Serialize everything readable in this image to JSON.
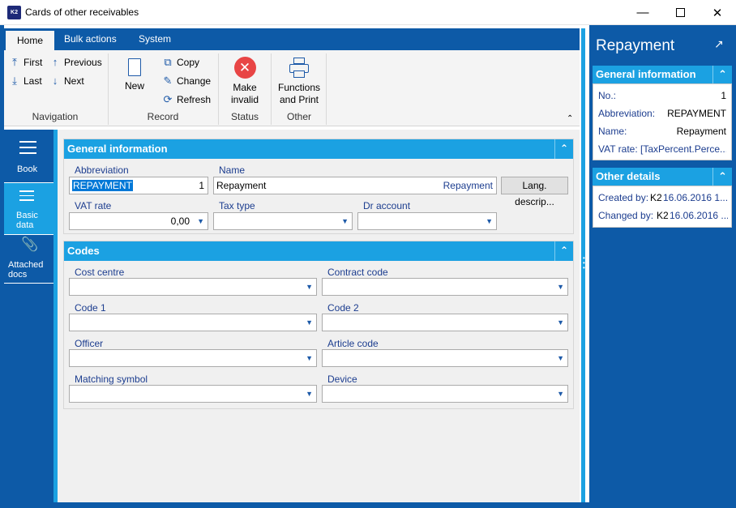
{
  "window": {
    "title": "Cards of other receivables",
    "icon_text": "K2"
  },
  "ribbon": {
    "tabs": [
      "Home",
      "Bulk actions",
      "System"
    ],
    "navigation": {
      "first": "First",
      "previous": "Previous",
      "last": "Last",
      "next": "Next",
      "group": "Navigation"
    },
    "record": {
      "new": "New",
      "copy": "Copy",
      "change": "Change",
      "refresh": "Refresh",
      "group": "Record"
    },
    "status": {
      "make_invalid_1": "Make",
      "make_invalid_2": "invalid",
      "group": "Status"
    },
    "other": {
      "functions_1": "Functions",
      "functions_2": "and Print",
      "group": "Other"
    }
  },
  "leftnav": {
    "book": "Book",
    "basic_1": "Basic",
    "basic_2": "data",
    "attached_1": "Attached",
    "attached_2": "docs"
  },
  "general": {
    "header": "General information",
    "abbreviation_label": "Abbreviation",
    "abbreviation_value": "REPAYMENT",
    "abbreviation_num": "1",
    "name_label": "Name",
    "name_value": "Repayment",
    "name_right": "Repayment",
    "lang_button": "Lang. descrip...",
    "vat_label": "VAT rate",
    "vat_value": "0,00",
    "taxtype_label": "Tax type",
    "dr_label": "Dr account"
  },
  "codes": {
    "header": "Codes",
    "cost_centre": "Cost centre",
    "contract_code": "Contract code",
    "code1": "Code 1",
    "code2": "Code 2",
    "officer": "Officer",
    "article_code": "Article code",
    "matching_symbol": "Matching symbol",
    "device": "Device"
  },
  "panel": {
    "title": "Repayment",
    "general_header": "General information",
    "no_label": "No.:",
    "no_value": "1",
    "abbr_label": "Abbreviation:",
    "abbr_value": "REPAYMENT",
    "name_label": "Name:",
    "name_value": "Repayment",
    "vat_label": "VAT rate:",
    "vat_value": "[TaxPercent.Perce...",
    "other_header": "Other details",
    "created_label": "Created by:",
    "created_user": "K2",
    "created_date": "16.06.2016 1...",
    "changed_label": "Changed by:",
    "changed_user": "K2",
    "changed_date": "16.06.2016 ..."
  }
}
